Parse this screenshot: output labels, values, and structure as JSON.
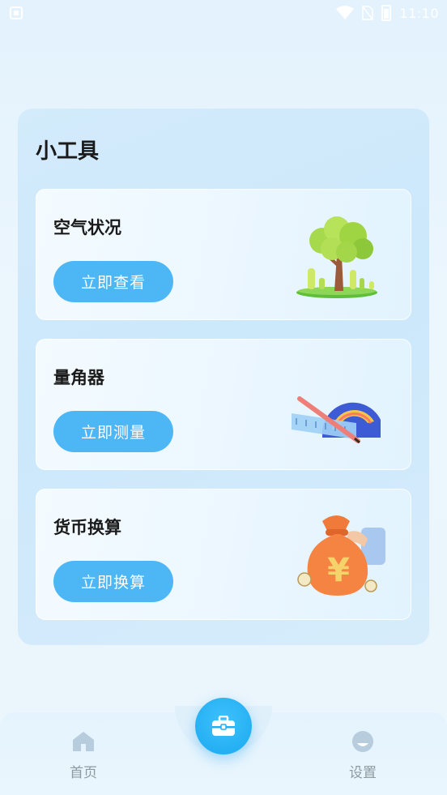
{
  "status_bar": {
    "time": "11:10"
  },
  "tools": {
    "title": "小工具",
    "items": [
      {
        "name": "空气状况",
        "button": "立即查看",
        "illustration": "tree-icon"
      },
      {
        "name": "量角器",
        "button": "立即测量",
        "illustration": "protractor-icon"
      },
      {
        "name": "货币换算",
        "button": "立即换算",
        "illustration": "money-bag-icon"
      }
    ]
  },
  "bottom_nav": {
    "home_label": "首页",
    "center_icon": "toolbox-icon",
    "settings_label": "设置"
  },
  "colors": {
    "accent": "#4db7f6",
    "center_button": "#1aa9f0",
    "nav_label": "#8c9aa4"
  }
}
